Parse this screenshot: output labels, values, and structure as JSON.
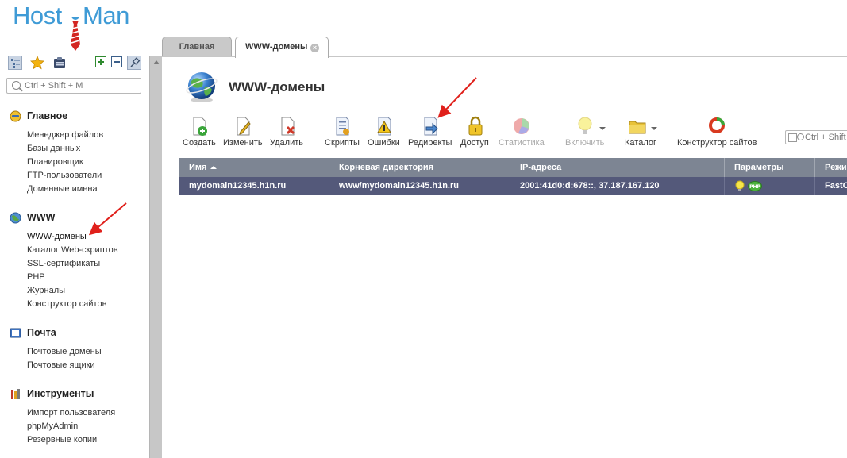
{
  "logo": {
    "text_left": "Host",
    "text_right": "Man"
  },
  "sidebar": {
    "toolbar": [
      {
        "name": "tree-view-icon"
      },
      {
        "name": "favorites-star-icon"
      },
      {
        "name": "clipboard-icon"
      },
      {
        "name": "expand-all-icon"
      },
      {
        "name": "collapse-all-icon"
      },
      {
        "name": "pin-icon"
      }
    ],
    "search_placeholder": "Ctrl + Shift + M",
    "sections": [
      {
        "title": "Главное",
        "icon": "main-icon",
        "items": [
          "Менеджер файлов",
          "Базы данных",
          "Планировщик",
          "FTP-пользователи",
          "Доменные имена"
        ]
      },
      {
        "title": "WWW",
        "icon": "www-globe-icon",
        "items": [
          "WWW-домены",
          "Каталог Web-скриптов",
          "SSL-сертификаты",
          "PHP",
          "Журналы",
          "Конструктор сайтов"
        ]
      },
      {
        "title": "Почта",
        "icon": "mail-icon",
        "items": [
          "Почтовые домены",
          "Почтовые ящики"
        ]
      },
      {
        "title": "Инструменты",
        "icon": "tools-icon",
        "items": [
          "Импорт пользователя",
          "phpMyAdmin",
          "Резервные копии"
        ]
      }
    ]
  },
  "tabs": [
    {
      "label": "Главная",
      "active": false
    },
    {
      "label": "WWW-домены",
      "active": true
    }
  ],
  "page": {
    "title": "WWW-домены"
  },
  "toolbar": [
    {
      "label": "Создать",
      "icon": "create-icon",
      "disabled": false
    },
    {
      "label": "Изменить",
      "icon": "edit-icon",
      "disabled": false
    },
    {
      "label": "Удалить",
      "icon": "delete-icon",
      "disabled": false
    },
    {
      "label": "Скрипты",
      "icon": "scripts-icon",
      "disabled": false
    },
    {
      "label": "Ошибки",
      "icon": "errors-icon",
      "disabled": false
    },
    {
      "label": "Редиректы",
      "icon": "redirects-icon",
      "disabled": false
    },
    {
      "label": "Доступ",
      "icon": "access-lock-icon",
      "disabled": false
    },
    {
      "label": "Статистика",
      "icon": "statistics-icon",
      "disabled": true
    },
    {
      "label": "Включить",
      "icon": "enable-bulb-icon",
      "disabled": true
    },
    {
      "label": "Каталог",
      "icon": "catalog-folder-icon",
      "disabled": false
    },
    {
      "label": "Конструктор сайтов",
      "icon": "site-builder-icon",
      "disabled": false
    }
  ],
  "grid_search_placeholder": "Ctrl + Shift",
  "table": {
    "columns": [
      "Имя",
      "Корневая директория",
      "IP-адреса",
      "Параметры",
      "Режи"
    ],
    "rows": [
      {
        "name": "mydomain12345.h1n.ru",
        "root": "www/mydomain12345.h1n.ru",
        "ips": "2001:41d0:d:678::, 37.187.167.120",
        "params": [
          "bulb-icon",
          "php-badge-icon"
        ],
        "param_php": "PHP",
        "mode": "FastC"
      }
    ]
  },
  "colors": {
    "brand": "#3f9bd6",
    "annotation_arrow": "#e0201b",
    "header_bg": "#7d8593",
    "selected_row": "#54597a"
  }
}
